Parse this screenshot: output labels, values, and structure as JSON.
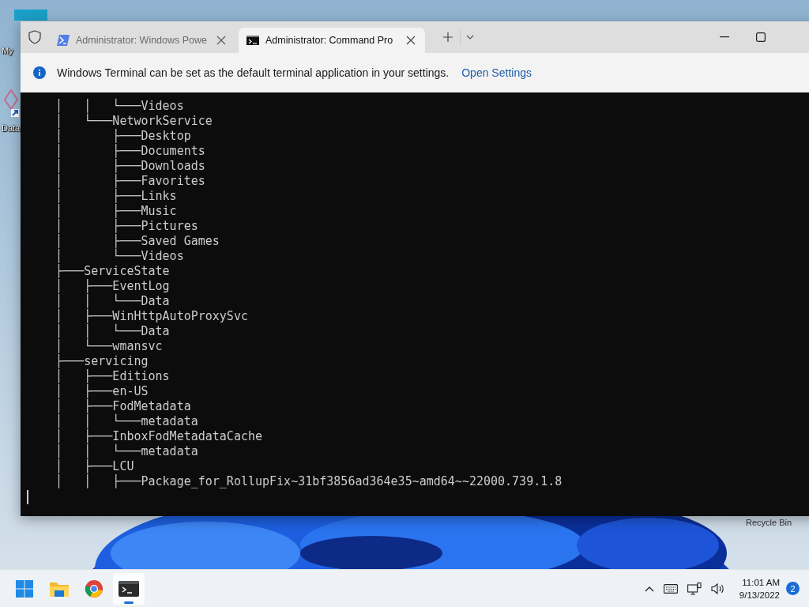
{
  "desktop_icons": [
    {
      "label": "My",
      "kind": "computer"
    },
    {
      "label": "Data",
      "kind": "shortcut"
    },
    {
      "label": "Recycle Bin",
      "kind": "bin"
    }
  ],
  "window": {
    "tabs": [
      {
        "title": "Administrator: Windows Powe",
        "kind": "powershell",
        "selected": false
      },
      {
        "title": "Administrator: Command Pro",
        "kind": "cmd",
        "selected": true
      }
    ],
    "info_bar": {
      "message": "Windows Terminal can be set as the default terminal application in your settings.",
      "link": "Open Settings"
    },
    "terminal_lines": [
      "    │   │   └───Videos",
      "    │   └───NetworkService",
      "    │       ├───Desktop",
      "    │       ├───Documents",
      "    │       ├───Downloads",
      "    │       ├───Favorites",
      "    │       ├───Links",
      "    │       ├───Music",
      "    │       ├───Pictures",
      "    │       ├───Saved Games",
      "    │       └───Videos",
      "    ├───ServiceState",
      "    │   ├───EventLog",
      "    │   │   └───Data",
      "    │   ├───WinHttpAutoProxySvc",
      "    │   │   └───Data",
      "    │   └───wmansvc",
      "    ├───servicing",
      "    │   ├───Editions",
      "    │   ├───en-US",
      "    │   ├───FodMetadata",
      "    │   │   └───metadata",
      "    │   ├───InboxFodMetadataCache",
      "    │   │   └───metadata",
      "    │   ├───LCU",
      "    │   │   ├───Package_for_RollupFix~31bf3856ad364e35~amd64~~22000.739.1.8"
    ]
  },
  "taskbar": {
    "apps": [
      {
        "kind": "start",
        "selected": false
      },
      {
        "kind": "explorer",
        "selected": false
      },
      {
        "kind": "browser",
        "selected": false
      },
      {
        "kind": "terminal",
        "selected": true
      }
    ],
    "time": "11:01 AM",
    "date": "9/13/2022",
    "notifications": "2"
  }
}
